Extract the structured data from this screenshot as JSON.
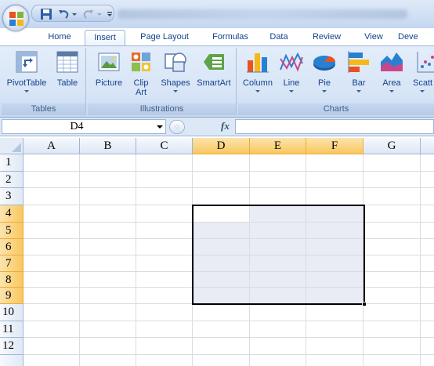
{
  "ribbon_tabs": [
    "Home",
    "Insert",
    "Page Layout",
    "Formulas",
    "Data",
    "Review",
    "View",
    "Deve"
  ],
  "active_tab": "Insert",
  "groups": {
    "tables": {
      "label": "Tables",
      "commands": [
        {
          "label": "PivotTable",
          "icon": "pivottable-icon",
          "has_dropdown": true
        },
        {
          "label": "Table",
          "icon": "table-icon",
          "has_dropdown": false
        }
      ]
    },
    "illustrations": {
      "label": "Illustrations",
      "commands": [
        {
          "label": "Picture",
          "icon": "picture-icon",
          "has_dropdown": false
        },
        {
          "label": "Clip\nArt",
          "icon": "clip-art-icon",
          "has_dropdown": false
        },
        {
          "label": "Shapes",
          "icon": "shapes-icon",
          "has_dropdown": true
        },
        {
          "label": "SmartArt",
          "icon": "smartart-icon",
          "has_dropdown": false
        }
      ]
    },
    "charts": {
      "label": "Charts",
      "commands": [
        {
          "label": "Column",
          "icon": "column-chart-icon",
          "has_dropdown": true
        },
        {
          "label": "Line",
          "icon": "line-chart-icon",
          "has_dropdown": true
        },
        {
          "label": "Pie",
          "icon": "pie-chart-icon",
          "has_dropdown": true
        },
        {
          "label": "Bar",
          "icon": "bar-chart-icon",
          "has_dropdown": true
        },
        {
          "label": "Area",
          "icon": "area-chart-icon",
          "has_dropdown": true
        },
        {
          "label": "Scatt",
          "icon": "scatter-chart-icon",
          "has_dropdown": true
        }
      ]
    }
  },
  "formula_bar": {
    "name_box": "D4",
    "fx_label": "fx",
    "formula": ""
  },
  "grid": {
    "columns": [
      "A",
      "B",
      "C",
      "D",
      "E",
      "F",
      "G"
    ],
    "rows": [
      "1",
      "2",
      "3",
      "4",
      "5",
      "6",
      "7",
      "8",
      "9",
      "10",
      "11",
      "12"
    ],
    "active_cell": "D4",
    "selected_range": "D4:F9",
    "selected_columns": [
      "D",
      "E",
      "F"
    ],
    "selected_rows": [
      "4",
      "5",
      "6",
      "7",
      "8",
      "9"
    ]
  },
  "colors": {
    "ribbon_bg": "#d6e4f6",
    "header_selected": "#f8c85f",
    "selection_fill": "#e9ebf5",
    "gridline": "#dadcdd"
  }
}
